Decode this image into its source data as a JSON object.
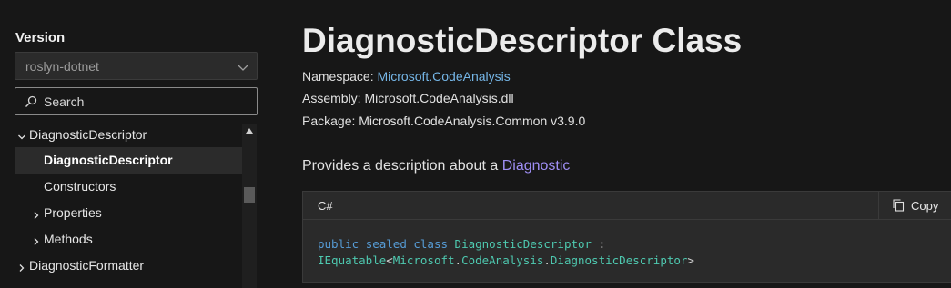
{
  "sidebar": {
    "version_label": "Version",
    "version_selected": "roslyn-dotnet",
    "search_placeholder": "Search",
    "tree": [
      {
        "label": "DiagnosticDescriptor"
      },
      {
        "label": "DiagnosticDescriptor"
      },
      {
        "label": "Constructors"
      },
      {
        "label": "Properties"
      },
      {
        "label": "Methods"
      },
      {
        "label": "DiagnosticFormatter"
      }
    ]
  },
  "main": {
    "title": "DiagnosticDescriptor Class",
    "namespace_label": "Namespace:",
    "namespace_value": "Microsoft.CodeAnalysis",
    "assembly_label": "Assembly:",
    "assembly_value": "Microsoft.CodeAnalysis.dll",
    "package_label": "Package:",
    "package_value": "Microsoft.CodeAnalysis.Common v3.9.0",
    "description_text": "Provides a description about a",
    "description_link": "Diagnostic",
    "code_language": "C#",
    "copy_label": "Copy",
    "code": {
      "kw_public": "public",
      "kw_sealed": "sealed",
      "kw_class": "class",
      "class_name": "DiagnosticDescriptor",
      "colon": ":",
      "iface": "IEquatable",
      "lt": "<",
      "ns1": "Microsoft",
      "dot": ".",
      "ns2": "CodeAnalysis",
      "gen_type": "DiagnosticDescriptor",
      "gt": ">"
    }
  },
  "colors": {
    "background": "#171717",
    "link_blue": "#75b6e7",
    "link_purple": "#9f8ff5",
    "keyword": "#569cd6",
    "type": "#4ec9b0"
  }
}
